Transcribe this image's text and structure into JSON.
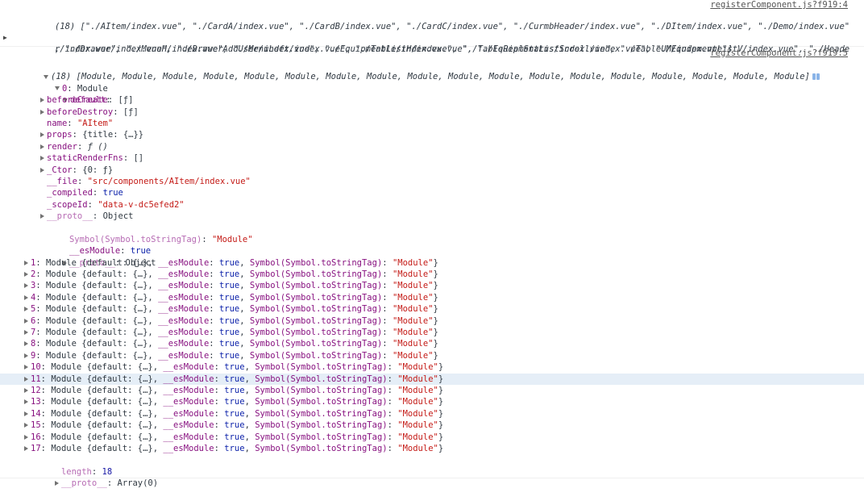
{
  "log1": {
    "source": "registerComponent.js?f919:4",
    "line1": "(18) [\"./AItem/index.vue\", \"./CardA/index.vue\", \"./CardB/index.vue\", \"./CardC/index.vue\", \"./CurmbHeader/index.vue\", \"./DItem/index.vue\", \"./Demo/index.vue\"",
    "line2": ", \"./Drawer/index.vue\", \"./DrawerAddUser/index.vue\", \"./EquipmentListH/index.vue\", \"./EquipmentListScroll/index.vue\", \"./EquipmentListV/index.vue\", \"./Heade",
    "line3": "r/index.vue\", \"./MenuH/index.vue\", \"./MenuLeft/index.vue\", \"./Table/index.vue\", \"./TableRealStatus/index.vue\", \"./TableUM/index.vue\"]"
  },
  "log2": {
    "source": "registerComponent.js?f919:5",
    "summary": "(18) [Module, Module, Module, Module, Module, Module, Module, Module, Module, Module, Module, Module, Module, Module, Module, Module, Module, Module]",
    "item0": {
      "index": "0",
      "label": "Module",
      "default_key": "default",
      "props": [
        {
          "key": "beforeCreate",
          "value": "[ƒ]",
          "expandable": true
        },
        {
          "key": "beforeDestroy",
          "value": "[ƒ]",
          "expandable": true
        },
        {
          "key": "name",
          "value": "\"AItem\"",
          "expandable": false,
          "type": "str"
        },
        {
          "key": "props",
          "value": "{title: {…}}",
          "expandable": true
        },
        {
          "key": "render",
          "value": "ƒ ()",
          "expandable": true,
          "italic": true
        },
        {
          "key": "staticRenderFns",
          "value": "[]",
          "expandable": true
        },
        {
          "key": "_Ctor",
          "value": "{0: ƒ}",
          "expandable": true
        },
        {
          "key": "__file",
          "value": "\"src/components/AItem/index.vue\"",
          "expandable": false,
          "type": "str"
        },
        {
          "key": "_compiled",
          "value": "true",
          "expandable": false,
          "type": "kw"
        },
        {
          "key": "_scopeId",
          "value": "\"data-v-dc5efed2\"",
          "expandable": false,
          "type": "str"
        },
        {
          "key": "__proto__",
          "value": "Object",
          "expandable": true
        }
      ],
      "symbol_key": "Symbol(Symbol.toStringTag)",
      "symbol_value": "\"Module\"",
      "esmodule_key": "__esModule",
      "esmodule_value": "true",
      "proto_key": "__proto__",
      "proto_value": "Object"
    },
    "row_parts": {
      "label": "Module",
      "default_text": "{default: {…}, ",
      "esmodule_key": "__esModule",
      "esmodule_value": "true",
      "symbol_key": "Symbol(Symbol.toStringTag)",
      "symbol_value": "\"Module\""
    },
    "rows": [
      "1",
      "2",
      "3",
      "4",
      "5",
      "6",
      "7",
      "8",
      "9",
      "10",
      "11",
      "12",
      "13",
      "14",
      "15",
      "16",
      "17"
    ],
    "highlighted_row": "11",
    "length_key": "length",
    "length_value": "18",
    "proto_key": "__proto__",
    "proto_value": "Array(0)"
  }
}
